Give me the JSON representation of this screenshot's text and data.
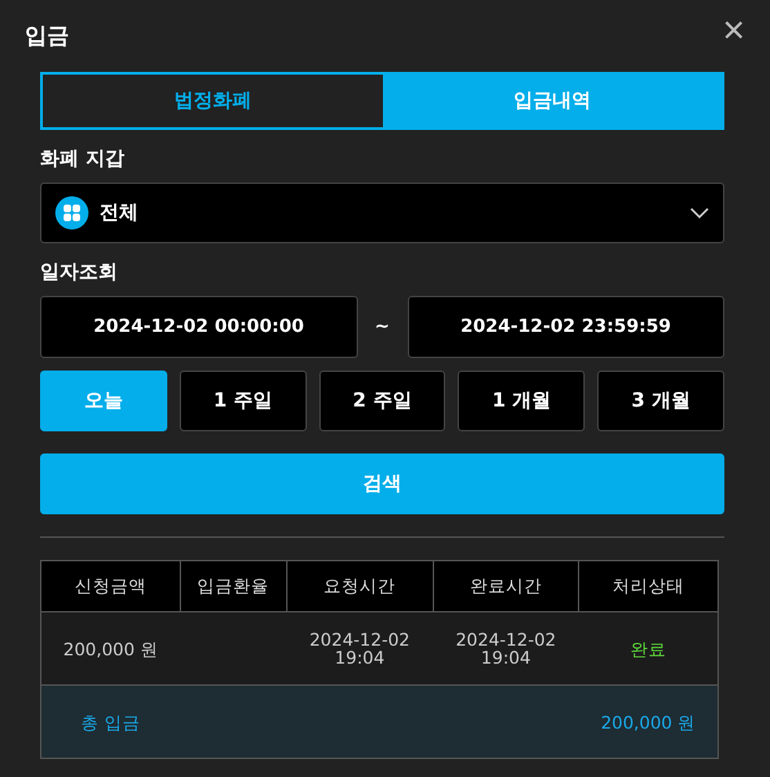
{
  "window": {
    "title": "입금",
    "close": "×"
  },
  "tabs": [
    {
      "label": "법정화폐",
      "selected": false
    },
    {
      "label": "입금내역",
      "selected": true
    }
  ],
  "wallet": {
    "label": "화폐 지갑",
    "value": "전체"
  },
  "date_range": {
    "label": "일자조회",
    "from": "2024-12-02 00:00:00",
    "separator": "~",
    "to": "2024-12-02 23:59:59"
  },
  "periods": [
    {
      "label": "오늘",
      "selected": true
    },
    {
      "label": "1 주일",
      "selected": false
    },
    {
      "label": "2 주일",
      "selected": false
    },
    {
      "label": "1 개월",
      "selected": false
    },
    {
      "label": "3 개월",
      "selected": false
    }
  ],
  "search_button": "검색",
  "table": {
    "columns": [
      "신청금액",
      "입금환율",
      "요청시간",
      "완료시간",
      "처리상태"
    ],
    "rows": [
      {
        "amount": "200,000 원",
        "request_time": [
          "2024-12-02",
          "19:04"
        ],
        "complete_time": [
          "2024-12-02",
          "19:04"
        ],
        "status": "완료",
        "kind": "complete"
      }
    ],
    "total": {
      "label": "총 입금",
      "value": "200,000 원"
    }
  }
}
